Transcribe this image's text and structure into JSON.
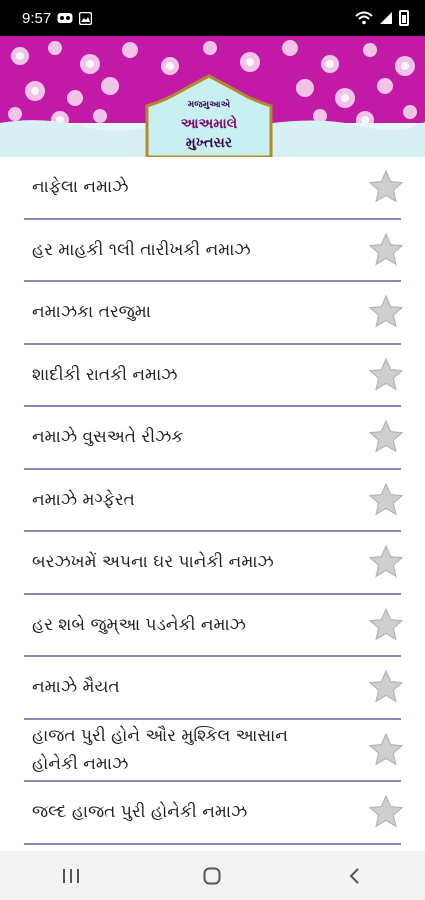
{
  "status_bar": {
    "time": "9:57",
    "icons": [
      "voicemail-icon",
      "gallery-icon",
      "wifi-icon",
      "signal-icon",
      "battery-icon"
    ]
  },
  "header": {
    "title_small": "મજમુઆએ",
    "title_main": "આઅમાલે",
    "title_sub": "મુખ્તસર",
    "colors": {
      "banner": "#c21aa6",
      "plaque": "#e8f7f9",
      "text": "#3a0a56"
    }
  },
  "list": {
    "items": [
      {
        "label": "નાફેલા નમાઝે"
      },
      {
        "label": "હર માહકી ૧લી તારીખકી નમાઝ"
      },
      {
        "label": "નમાઝકા તરજુમા"
      },
      {
        "label": "શાદીકી રાતકી નમાઝ"
      },
      {
        "label": "નમાઝે વુસઅતે રીઝક"
      },
      {
        "label": "નમાઝે મગ્ફેરત"
      },
      {
        "label": "બરઝખમેં અપના ઘર પાનેકી નમાઝ"
      },
      {
        "label": "હર શબે જુમ્આ પડનેકી નમાઝ"
      },
      {
        "label": "નમાઝે મૈયત"
      },
      {
        "label": "હાજત પુરી હોને ઔર મુશ્કિલ આસાન હોનેકી નમાઝ"
      },
      {
        "label": "જલ્દ હાજત પુરી હોનેકી નમાઝ"
      }
    ],
    "divider_color": "#8e84b8",
    "star_color": "#c8c8c8"
  },
  "nav_bar": {
    "buttons": [
      "recent-apps-icon",
      "home-icon",
      "back-icon"
    ]
  }
}
